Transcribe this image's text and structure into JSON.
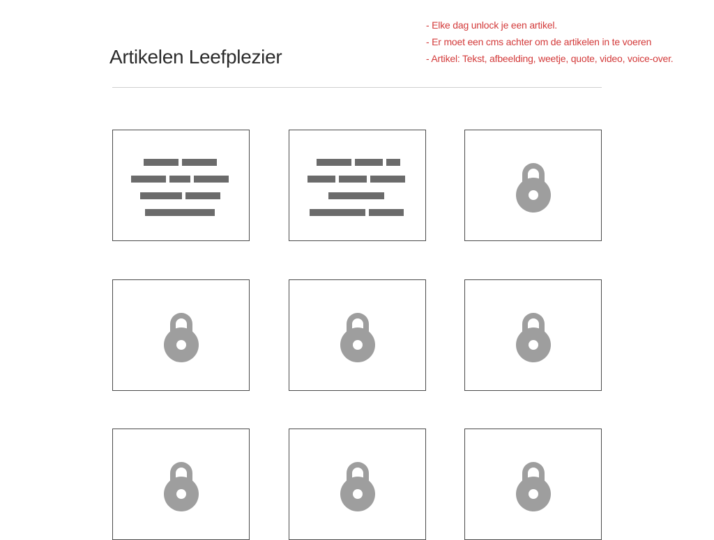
{
  "page": {
    "title": "Artikelen Leefplezier",
    "notes": [
      "- Elke dag unlock je een artikel.",
      "- Er moet een cms achter om de artikelen in te voeren",
      "- Artikel: Tekst, afbeelding, weetje, quote, video, voice-over."
    ]
  },
  "colors": {
    "note_text": "#d33a3a",
    "placeholder_bar": "#6b6b6b",
    "lock_icon": "#9e9e9e",
    "card_border": "#4a4a4a"
  },
  "articles": [
    {
      "state": "unlocked",
      "icon": "text-placeholder"
    },
    {
      "state": "unlocked",
      "icon": "text-placeholder"
    },
    {
      "state": "locked",
      "icon": "lock-icon"
    },
    {
      "state": "locked",
      "icon": "lock-icon"
    },
    {
      "state": "locked",
      "icon": "lock-icon"
    },
    {
      "state": "locked",
      "icon": "lock-icon"
    },
    {
      "state": "locked",
      "icon": "lock-icon"
    },
    {
      "state": "locked",
      "icon": "lock-icon"
    },
    {
      "state": "locked",
      "icon": "lock-icon"
    }
  ]
}
